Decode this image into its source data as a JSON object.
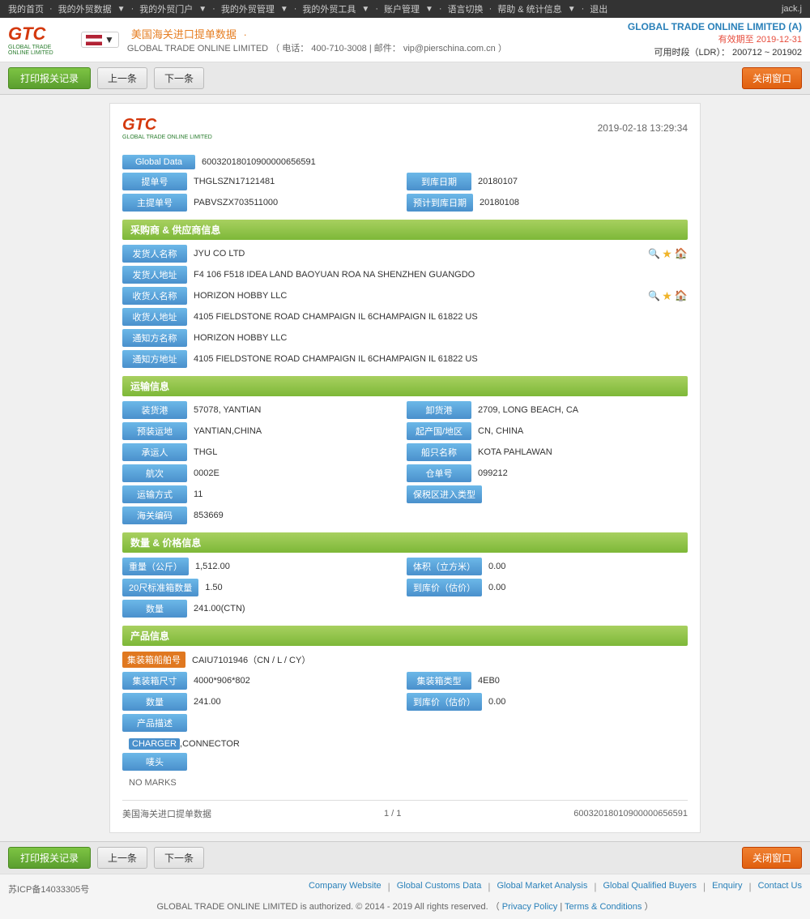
{
  "topnav": {
    "items": [
      "我的首页",
      "我的外贸数据",
      "我的外贸门户",
      "我的外贸管理",
      "我的外贸工具",
      "账户管理",
      "语言切换",
      "帮助 & 统计信息",
      "退出"
    ],
    "user": "jack.j"
  },
  "header": {
    "title": "美国海关进口提单数据",
    "separator": "·",
    "phone_label": "电话：",
    "phone": "400-710-3008",
    "email_label": "邮件：",
    "email": "vip@pierschina.com.cn",
    "company": "GLOBAL TRADE ONLINE LIMITED (A)",
    "validity_label": "有效期至",
    "validity_date": "2019-12-31",
    "time_label": "可用时段（LDR）：",
    "time_range": "200712 ~ 201902"
  },
  "toolbar": {
    "print_btn": "打印报关记录",
    "prev_btn": "上一条",
    "next_btn": "下一条",
    "close_btn": "关闭窗口"
  },
  "card": {
    "datetime": "2019-02-18 13:29:34",
    "global_data_label": "Global Data",
    "global_data_value": "60032018010900000656591",
    "bill_no_label": "提单号",
    "bill_no_value": "THGLSZN17121481",
    "arrival_date_label": "到库日期",
    "arrival_date_value": "20180107",
    "master_bill_label": "主提单号",
    "master_bill_value": "PABVSZX703511000",
    "est_arrival_label": "预计到库日期",
    "est_arrival_value": "20180108"
  },
  "buyer_supplier": {
    "section_title": "采购商 & 供应商信息",
    "shipper_name_label": "发货人名称",
    "shipper_name_value": "JYU CO LTD",
    "shipper_addr_label": "发货人地址",
    "shipper_addr_value": "F4 106 F518 IDEA LAND BAOYUAN ROA NA SHENZHEN GUANGDO",
    "consignee_name_label": "收货人名称",
    "consignee_name_value": "HORIZON HOBBY LLC",
    "consignee_addr_label": "收货人地址",
    "consignee_addr_value": "4105 FIELDSTONE ROAD CHAMPAIGN IL 6CHAMPAIGN IL 61822 US",
    "notify_name_label": "通知方名称",
    "notify_name_value": "HORIZON HOBBY LLC",
    "notify_addr_label": "通知方地址",
    "notify_addr_value": "4105 FIELDSTONE ROAD CHAMPAIGN IL 6CHAMPAIGN IL 61822 US"
  },
  "transport": {
    "section_title": "运输信息",
    "loading_port_label": "装货港",
    "loading_port_value": "57078, YANTIAN",
    "unloading_port_label": "卸货港",
    "unloading_port_value": "2709, LONG BEACH, CA",
    "loading_place_label": "预装运地",
    "loading_place_value": "YANTIAN,CHINA",
    "origin_label": "起产国/地区",
    "origin_value": "CN, CHINA",
    "carrier_label": "承运人",
    "carrier_value": "THGL",
    "vessel_label": "船只名称",
    "vessel_value": "KOTA PAHLAWAN",
    "voyage_label": "航次",
    "voyage_value": "0002E",
    "bill_count_label": "仓单号",
    "bill_count_value": "099212",
    "transport_mode_label": "运输方式",
    "transport_mode_value": "11",
    "ftz_label": "保税区进入类型",
    "ftz_value": "",
    "customs_code_label": "海关编码",
    "customs_code_value": "853669"
  },
  "quantity_price": {
    "section_title": "数量 & 价格信息",
    "weight_label": "重量（公斤）",
    "weight_value": "1,512.00",
    "volume_label": "体积（立方米）",
    "volume_value": "0.00",
    "container20_label": "20尺标准箱数量",
    "container20_value": "1.50",
    "price_label": "到库价（估价）",
    "price_value": "0.00",
    "quantity_label": "数量",
    "quantity_value": "241.00(CTN)"
  },
  "product": {
    "section_title": "产品信息",
    "container_no_label": "集装箱船舶号",
    "container_no_value": "CAIU7101946（CN / L / CY）",
    "container_size_label": "集装箱尺寸",
    "container_size_value": "4000*906*802",
    "container_type_label": "集装箱类型",
    "container_type_value": "4EB0",
    "quantity_label": "数量",
    "quantity_value": "241.00",
    "price2_label": "到库价（估价）",
    "price2_value": "0.00",
    "desc_title": "产品描述",
    "desc_highlight": "CHARGER",
    "desc_rest": ",CONNECTOR",
    "marks_label": "唛头",
    "marks_value": "NO MARKS"
  },
  "card_footer": {
    "source": "美国海关进口提单数据",
    "pagination": "1 / 1",
    "record_id": "60032018010900000656591"
  },
  "bottom_toolbar": {
    "print_btn": "打印报关记录",
    "prev_btn": "上一条",
    "next_btn": "下一条",
    "close_btn": "关闭窗口"
  },
  "footer": {
    "icp": "苏ICP备14033305号",
    "links": [
      "Company Website",
      "Global Customs Data",
      "Global Market Analysis",
      "Global Qualified Buyers",
      "Enquiry",
      "Contact Us"
    ],
    "copyright": "GLOBAL TRADE ONLINE LIMITED is authorized. © 2014 - 2019 All rights reserved.",
    "privacy": "Privacy Policy",
    "terms": "Terms & Conditions"
  },
  "colors": {
    "green_btn": "#7dc443",
    "blue_label": "#4a90cc",
    "section_green": "#8cc63f",
    "orange_tag": "#e07820"
  }
}
